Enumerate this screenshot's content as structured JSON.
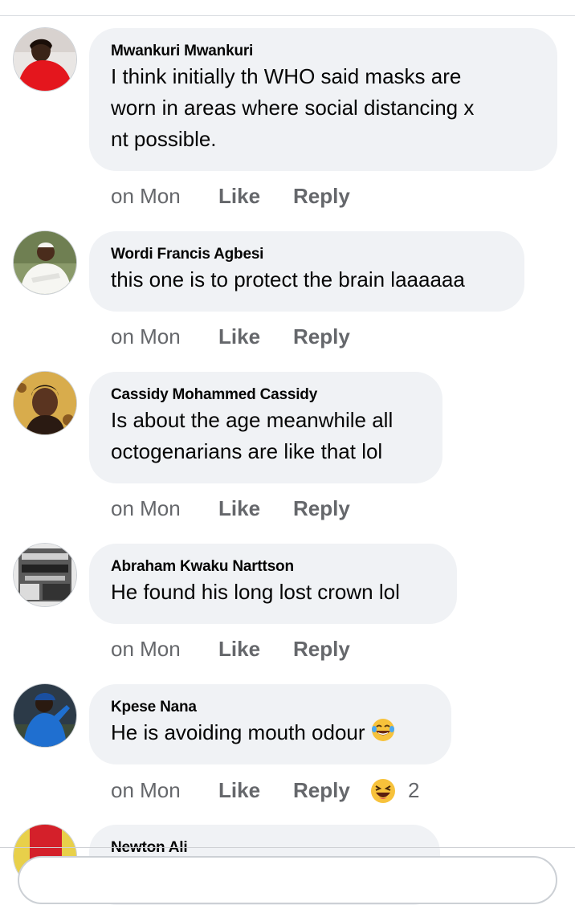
{
  "comments": [
    {
      "author": "Mwankuri Mwankuri",
      "text_lines": [
        "I think  initially  th WHO  said masks  are",
        "worn  in areas  where  social distancing  x",
        "nt possible."
      ],
      "time": "on Mon",
      "like": "Like",
      "reply": "Reply"
    },
    {
      "author": "Wordi Francis Agbesi",
      "text_lines": [
        "this one is to protect the brain laaaaaa"
      ],
      "time": "on Mon",
      "like": "Like",
      "reply": "Reply"
    },
    {
      "author": "Cassidy Mohammed Cassidy",
      "text_lines": [
        "Is about the age meanwhile all",
        "octogenarians are like that lol"
      ],
      "time": "on Mon",
      "like": "Like",
      "reply": "Reply"
    },
    {
      "author": "Abraham Kwaku Narttson",
      "text_lines": [
        "He found his long lost crown lol"
      ],
      "time": "on Mon",
      "like": "Like",
      "reply": "Reply"
    },
    {
      "author": "Kpese Nana",
      "text_lines": [
        "He is avoiding mouth odour"
      ],
      "text_emoji": "face-with-tears-of-joy-icon",
      "time": "on Mon",
      "like": "Like",
      "reply": "Reply",
      "reaction_icon": "haha-reaction-icon",
      "reaction_count": "2"
    },
    {
      "author": "Newton Ali"
    }
  ],
  "colors": {
    "bubble": "#f0f2f5",
    "meta_text": "#65676b",
    "primary_text": "#050505",
    "reaction_yellow": "#f7c23b"
  }
}
